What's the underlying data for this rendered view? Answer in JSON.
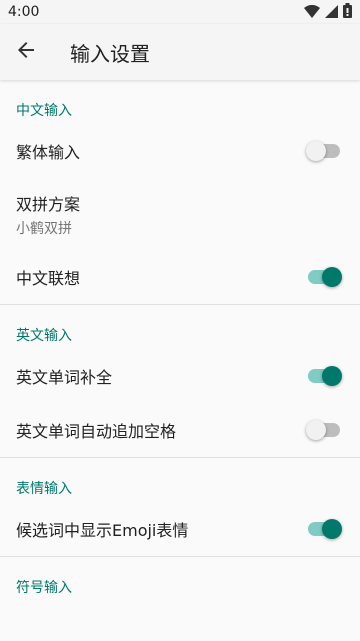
{
  "status_bar": {
    "time": "4:00"
  },
  "app_bar": {
    "title": "输入设置"
  },
  "colors": {
    "accent": "#00796b",
    "accent_track": "#80cbc4",
    "header_text": "#00796b"
  },
  "sections": [
    {
      "header": "中文输入",
      "items": [
        {
          "title": "繁体输入",
          "type": "switch",
          "checked": false
        },
        {
          "title": "双拼方案",
          "summary": "小鹤双拼",
          "type": "preference"
        },
        {
          "title": "中文联想",
          "type": "switch",
          "checked": true
        }
      ]
    },
    {
      "header": "英文输入",
      "items": [
        {
          "title": "英文单词补全",
          "type": "switch",
          "checked": true
        },
        {
          "title": "英文单词自动追加空格",
          "type": "switch",
          "checked": false
        }
      ]
    },
    {
      "header": "表情输入",
      "items": [
        {
          "title": "候选词中显示Emoji表情",
          "type": "switch",
          "checked": true
        }
      ]
    },
    {
      "header": "符号输入",
      "items": []
    }
  ]
}
